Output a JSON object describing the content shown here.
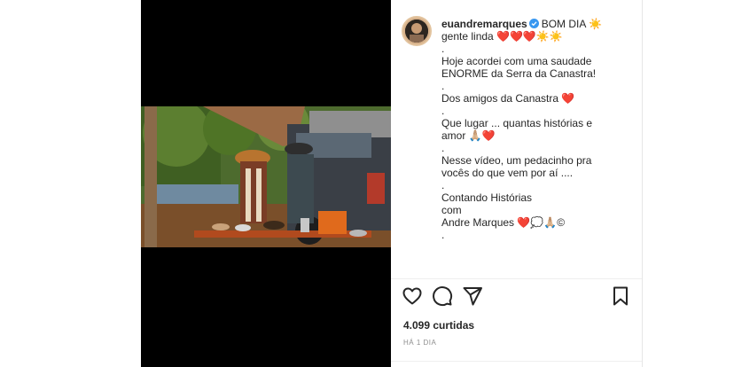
{
  "post": {
    "username": "euandremarques",
    "caption_lines": [
      {
        "text": "BOM DIA ☀️",
        "first": true
      },
      {
        "text": "gente linda ❤️❤️❤️☀️☀️"
      },
      {
        "text": "."
      },
      {
        "text": "Hoje acordei com uma saudade"
      },
      {
        "text": "ENORME da Serra da Canastra!"
      },
      {
        "text": "."
      },
      {
        "text": "Dos amigos da Canastra ❤️"
      },
      {
        "text": "."
      },
      {
        "text": "Que lugar ... quantas histórias e"
      },
      {
        "text": "amor 🙏🏼❤️"
      },
      {
        "text": "."
      },
      {
        "text": "Nesse vídeo, um pedacinho pra"
      },
      {
        "text": "vocês do que vem por aí ...."
      },
      {
        "text": "."
      },
      {
        "text": "Contando Histórias"
      },
      {
        "text": "com"
      },
      {
        "text": "Andre Marques ❤️💭🙏🏼©"
      },
      {
        "text": "."
      }
    ],
    "likes": "4.099 curtidas",
    "time": "HÁ 1 DIA"
  },
  "icons": {
    "like": "heart-icon",
    "comment": "comment-icon",
    "share": "share-icon",
    "save": "bookmark-icon",
    "verified": "verified-badge-icon"
  },
  "colors": {
    "verified": "#3897f0",
    "heart_emoji": "#e0245e",
    "text": "#262626",
    "muted": "#8e8e8e"
  }
}
